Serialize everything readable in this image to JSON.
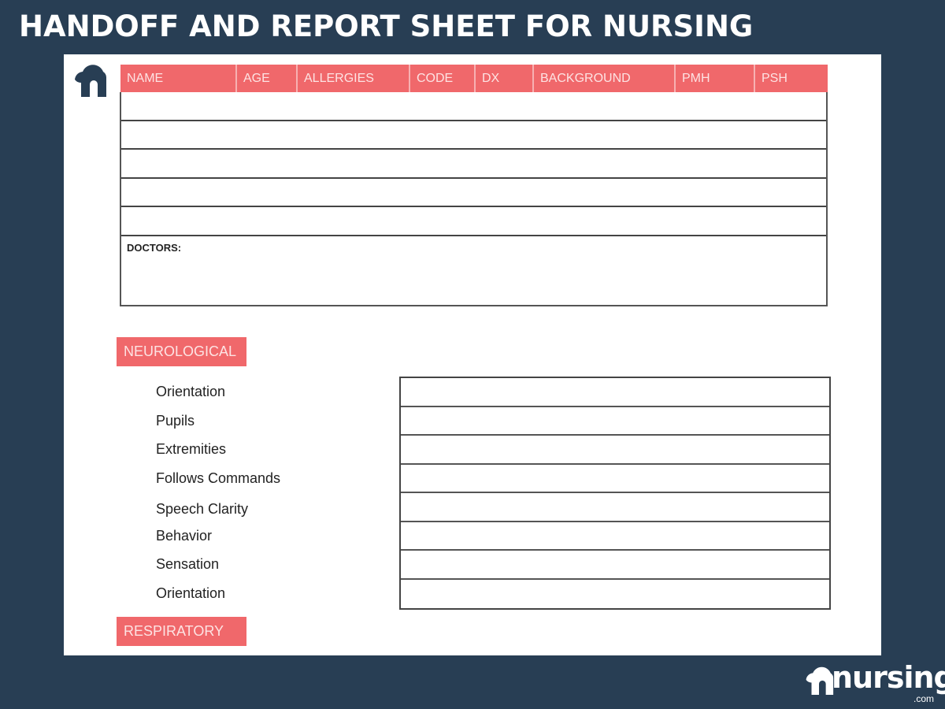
{
  "page_title": "HANDOFF AND REPORT SHEET FOR NURSING",
  "colors": {
    "background": "#283e54",
    "accent": "#f0686b",
    "accent_text": "#fde3e3",
    "sheet": "#ffffff"
  },
  "patient_table": {
    "columns": [
      "NAME",
      "AGE",
      "ALLERGIES",
      "CODE",
      "DX",
      "BACKGROUND",
      "PMH",
      "PSH"
    ],
    "rows": [
      [
        "",
        "",
        "",
        "",
        "",
        "",
        "",
        ""
      ],
      [
        "",
        "",
        "",
        "",
        "",
        "",
        "",
        ""
      ],
      [
        "",
        "",
        "",
        "",
        "",
        "",
        "",
        ""
      ],
      [
        "",
        "",
        "",
        "",
        "",
        "",
        "",
        ""
      ],
      [
        "",
        "",
        "",
        "",
        "",
        "",
        "",
        ""
      ]
    ],
    "doctors_label": "DOCTORS:",
    "doctors_value": ""
  },
  "sections": {
    "neurological": {
      "label": "NEUROLOGICAL",
      "items": [
        {
          "label": "Orientation",
          "value": ""
        },
        {
          "label": "Pupils",
          "value": ""
        },
        {
          "label": "Extremities",
          "value": ""
        },
        {
          "label": "Follows Commands",
          "value": ""
        },
        {
          "label": "Speech Clarity",
          "value": ""
        },
        {
          "label": "Behavior",
          "value": ""
        },
        {
          "label": "Sensation",
          "value": ""
        },
        {
          "label": "Orientation",
          "value": ""
        }
      ]
    },
    "respiratory": {
      "label": "RESPIRATORY"
    }
  },
  "brand": {
    "name": "nursing",
    "suffix": ".com",
    "logo_icon": "nursing-cloud-n-logo"
  }
}
